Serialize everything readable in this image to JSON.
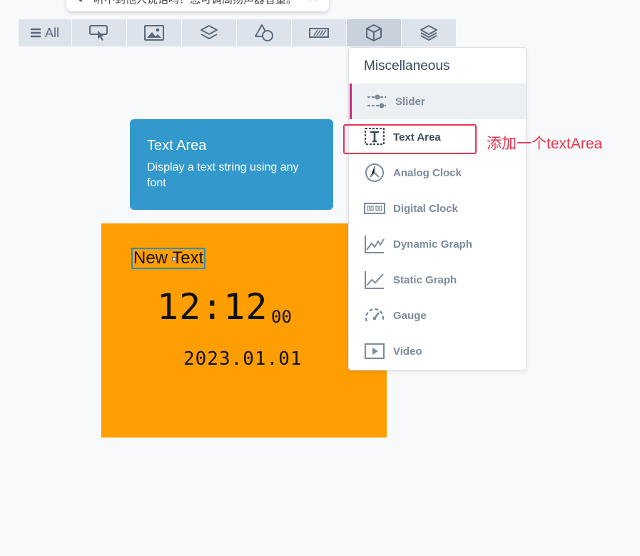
{
  "notification": {
    "text": "听不到他人说话吗？您可调高扬声器音量。"
  },
  "toolbar": {
    "all_label": "All",
    "buttons": [
      "all",
      "interaction-icon",
      "image-icon",
      "layers-icon",
      "shapes-icon",
      "progress-icon",
      "cube-icon",
      "stack-icon"
    ],
    "active_index": 6
  },
  "tooltip": {
    "title": "Text Area",
    "description": "Display a text string using any font"
  },
  "canvas": {
    "background": "#ff9e00",
    "text_area_value": "New Text",
    "clock_time": "12:12",
    "clock_seconds": "00",
    "date": "2023.01.01"
  },
  "dropdown": {
    "title": "Miscellaneous",
    "items": [
      {
        "label": "Slider",
        "icon": "slider-icon"
      },
      {
        "label": "Text Area",
        "icon": "text-area-icon"
      },
      {
        "label": "Analog Clock",
        "icon": "analog-clock-icon"
      },
      {
        "label": "Digital Clock",
        "icon": "digital-clock-icon"
      },
      {
        "label": "Dynamic Graph",
        "icon": "dynamic-graph-icon"
      },
      {
        "label": "Static Graph",
        "icon": "static-graph-icon"
      },
      {
        "label": "Gauge",
        "icon": "gauge-icon"
      },
      {
        "label": "Video",
        "icon": "video-icon"
      }
    ]
  },
  "annotation": {
    "text": "添加一个textArea",
    "color": "#e8344d"
  }
}
